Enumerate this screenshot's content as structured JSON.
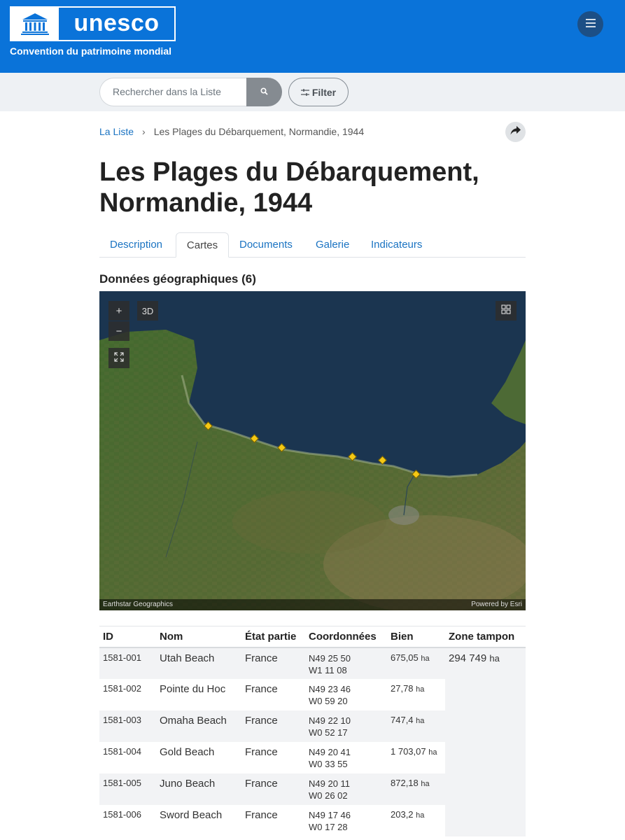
{
  "header": {
    "logo_text": "unesco",
    "subtitle": "Convention du patrimoine mondial",
    "brand_color": "#0a73d9"
  },
  "search": {
    "placeholder": "Rechercher dans la Liste",
    "filter_label": "Filter"
  },
  "breadcrumb": {
    "root": "La Liste",
    "current": "Les Plages du Débarquement, Normandie, 1944"
  },
  "page": {
    "title": "Les Plages du Débarquement, Normandie, 1944"
  },
  "tabs": [
    {
      "label": "Description",
      "active": false
    },
    {
      "label": "Cartes",
      "active": true
    },
    {
      "label": "Documents",
      "active": false
    },
    {
      "label": "Galerie",
      "active": false
    },
    {
      "label": "Indicateurs",
      "active": false
    }
  ],
  "geo": {
    "heading": "Données géographiques (6)"
  },
  "map": {
    "zoom_in": "+",
    "zoom_out": "−",
    "mode_3d": "3D",
    "attribution_left": "Earthstar Geographics",
    "attribution_right": "Powered by Esri"
  },
  "table": {
    "headers": {
      "id": "ID",
      "name": "Nom",
      "state": "État partie",
      "coords": "Coordonnées",
      "property": "Bien",
      "buffer": "Zone tampon"
    },
    "unit": "ha",
    "buffer_value": "294 749",
    "rows": [
      {
        "id": "1581-001",
        "name": "Utah Beach",
        "state": "France",
        "lat": "N49 25 50",
        "lon": "W1 11 08",
        "area": "675,05"
      },
      {
        "id": "1581-002",
        "name": "Pointe du Hoc",
        "state": "France",
        "lat": "N49 23 46",
        "lon": "W0 59 20",
        "area": "27,78"
      },
      {
        "id": "1581-003",
        "name": "Omaha Beach",
        "state": "France",
        "lat": "N49 22 10",
        "lon": "W0 52 17",
        "area": "747,4"
      },
      {
        "id": "1581-004",
        "name": "Gold Beach",
        "state": "France",
        "lat": "N49 20 41",
        "lon": "W0 33 55",
        "area": "1 703,07"
      },
      {
        "id": "1581-005",
        "name": "Juno Beach",
        "state": "France",
        "lat": "N49 20 11",
        "lon": "W0 26 02",
        "area": "872,18"
      },
      {
        "id": "1581-006",
        "name": "Sword Beach",
        "state": "France",
        "lat": "N49 17 46",
        "lon": "W0 17 28",
        "area": "203,2"
      }
    ]
  }
}
